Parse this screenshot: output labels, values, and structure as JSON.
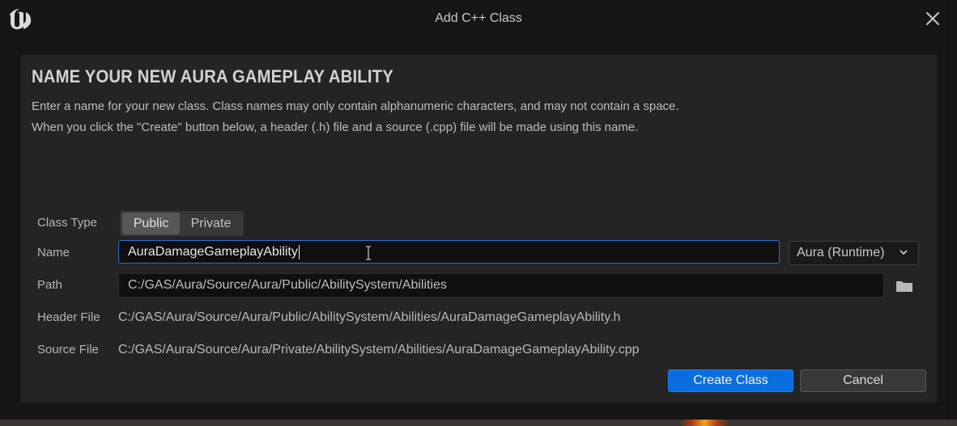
{
  "window": {
    "title": "Add C++ Class"
  },
  "panel": {
    "heading": "NAME YOUR NEW AURA GAMEPLAY ABILITY",
    "description_line1": "Enter a name for your new class. Class names may only contain alphanumeric characters, and may not contain a space.",
    "description_line2": "When you click the \"Create\" button below, a header (.h) file and a source (.cpp) file will be made using this name."
  },
  "form": {
    "class_type_label": "Class Type",
    "class_type_options": [
      "Public",
      "Private"
    ],
    "class_type_selected": "Public",
    "name_label": "Name",
    "name_value": "AuraDamageGameplayAbility",
    "module_value": "Aura (Runtime)",
    "path_label": "Path",
    "path_value": "C:/GAS/Aura/Source/Aura/Public/AbilitySystem/Abilities",
    "header_file_label": "Header File",
    "header_file_value": "C:/GAS/Aura/Source/Aura/Public/AbilitySystem/Abilities/AuraDamageGameplayAbility.h",
    "source_file_label": "Source File",
    "source_file_value": "C:/GAS/Aura/Source/Aura/Private/AbilitySystem/Abilities/AuraDamageGameplayAbility.cpp"
  },
  "buttons": {
    "create": "Create Class",
    "cancel": "Cancel"
  },
  "icons": {
    "logo": "unreal-engine-logo",
    "close": "close-icon",
    "dropdown": "chevron-down-icon",
    "browse": "folder-icon"
  },
  "colors": {
    "accent": "#0a6ee0",
    "focus_border": "#2a6fd0",
    "panel_bg": "#242424",
    "window_bg": "#161616"
  }
}
